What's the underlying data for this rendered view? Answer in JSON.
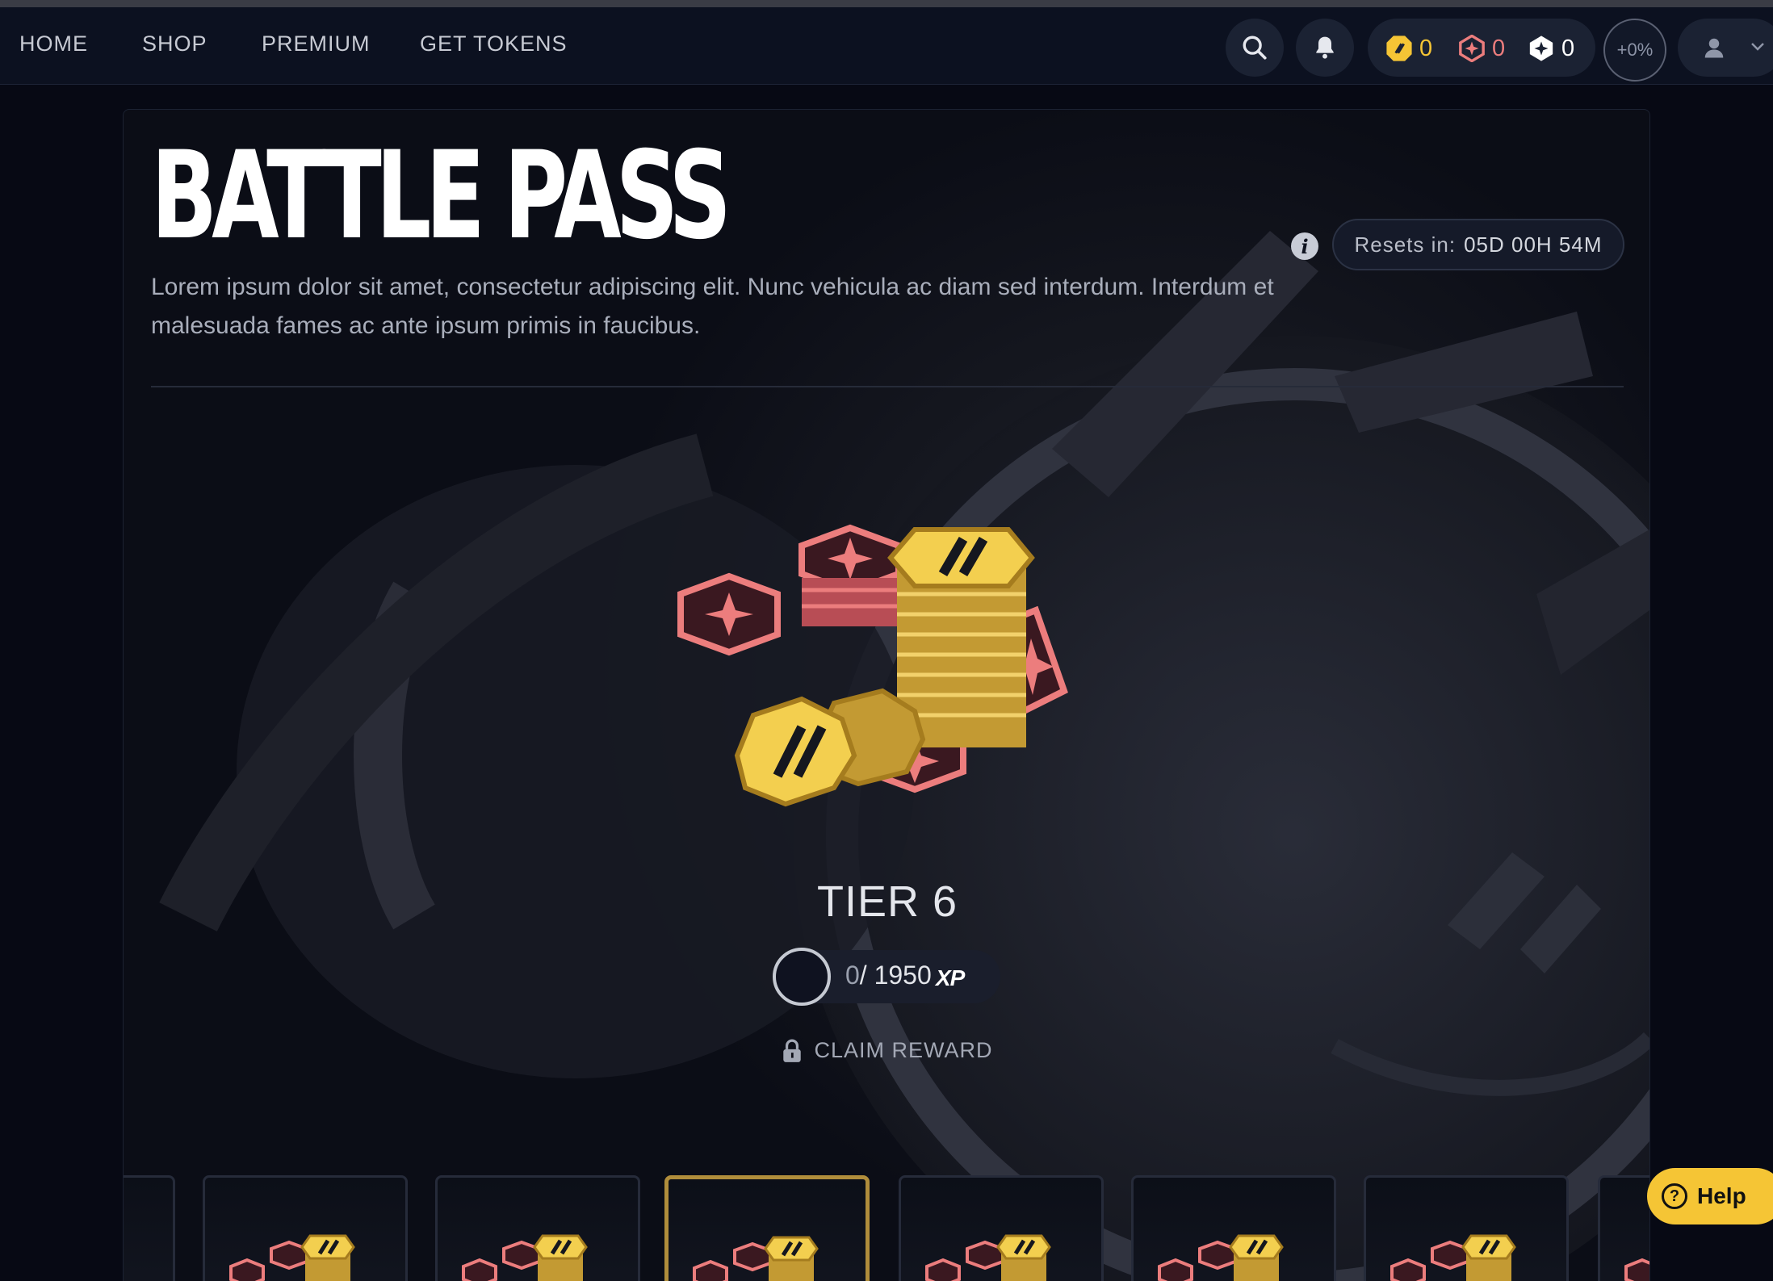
{
  "nav": {
    "links": [
      "HOME",
      "SHOP",
      "PREMIUM",
      "GET TOKENS"
    ],
    "currencies": [
      {
        "icon": "gold-token-icon",
        "value": "0",
        "color": "#f5c535"
      },
      {
        "icon": "red-gem-icon",
        "value": "0",
        "color": "#ec7d7d"
      },
      {
        "icon": "white-star-icon",
        "value": "0",
        "color": "#ffffff"
      }
    ],
    "xp_boost": "+0%"
  },
  "battle_pass": {
    "title": "BATTLE PASS",
    "description": "Lorem ipsum dolor sit amet, consectetur adipiscing elit. Nunc vehicula ac diam sed interdum. Interdum et malesuada fames ac ante ipsum primis in faucibus.",
    "resets_label": "Resets in:",
    "resets_value": "05D 00H 54M",
    "tier_label": "TIER 6",
    "xp_current": "0",
    "xp_total": "/ 1950",
    "xp_unit": "XP",
    "claim_label": "CLAIM REWARD",
    "active_slot": 3
  },
  "help": {
    "label": "Help"
  },
  "colors": {
    "accent": "#f5c535",
    "gem": "#ec7d7d",
    "background": "#070914"
  }
}
